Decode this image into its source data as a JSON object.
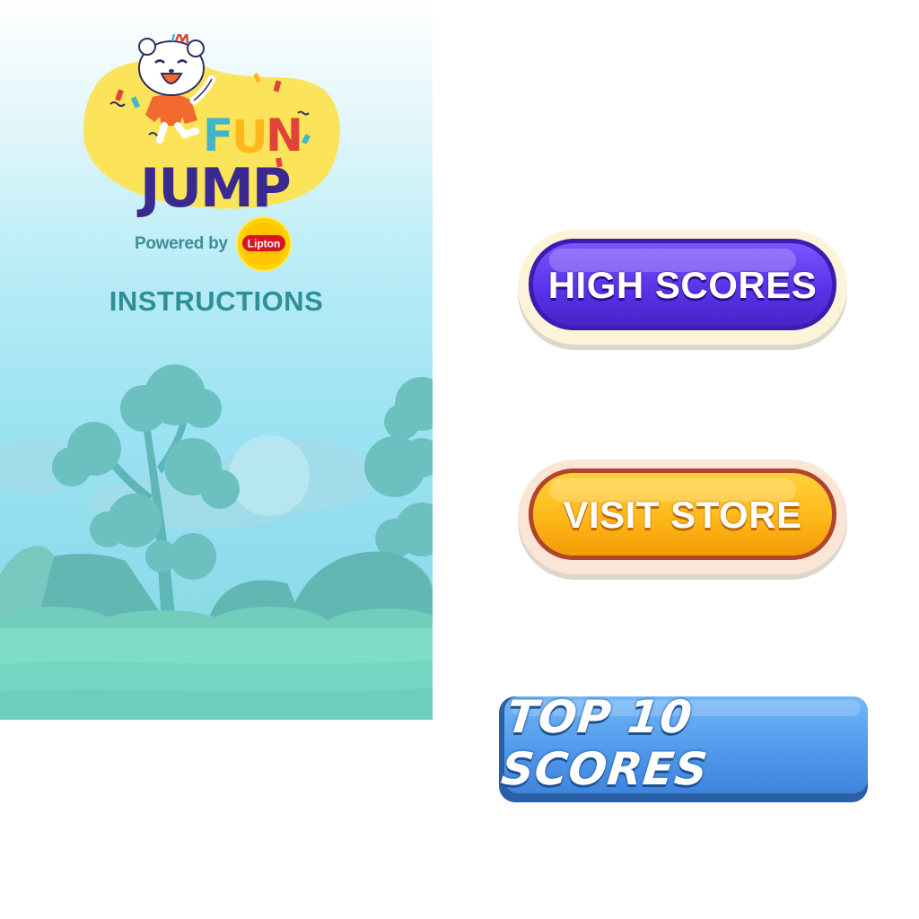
{
  "game": {
    "logo": {
      "line1": "FUN",
      "line2": "JUMP"
    },
    "powered_by": "Powered by",
    "sponsor": "Lipton",
    "instructions_label": "INSTRUCTIONS"
  },
  "buttons": {
    "high_scores": "HIGH SCORES",
    "visit_store": "VISIT STORE",
    "top_10_scores": "TOP 10 SCORES"
  },
  "colors": {
    "instructions_text": "#2f8f98",
    "high_scores_button": "#5a33ea",
    "visit_store_button": "#ffb81a",
    "top_10_button": "#4f97ea",
    "logo_blob": "#fbe35a",
    "logo_jump_text": "#3a2a8f"
  },
  "icons": {
    "mascot": "cat-mascot-icon",
    "sponsor_badge": "lipton-badge-icon"
  }
}
